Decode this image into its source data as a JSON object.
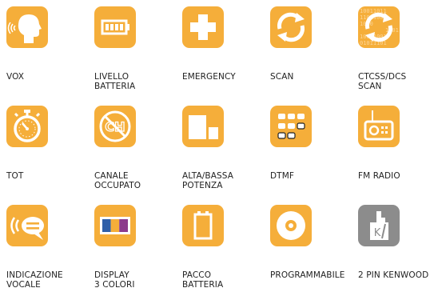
{
  "features": [
    {
      "label": [
        "VOX"
      ],
      "icon": "vox-head-icon"
    },
    {
      "label": [
        "LIVELLO",
        "BATTERIA"
      ],
      "icon": "battery-level-icon"
    },
    {
      "label": [
        "EMERGENCY"
      ],
      "icon": "emergency-cross-icon"
    },
    {
      "label": [
        "SCAN"
      ],
      "icon": "scan-arrows-icon"
    },
    {
      "label": [
        "CTCSS/DCS",
        "SCAN"
      ],
      "icon": "ctcss-dcs-scan-icon",
      "binary_text": [
        "10011011",
        "11011001",
        "1010",
        "1001",
        "10001001",
        "01011101"
      ]
    },
    {
      "label": [
        "TOT"
      ],
      "icon": "stopwatch-icon"
    },
    {
      "label": [
        "CANALE",
        "OCCUPATO"
      ],
      "icon": "busy-channel-icon",
      "glyph": "CH"
    },
    {
      "label": [
        "ALTA/BASSA",
        "POTENZA"
      ],
      "icon": "high-low-power-icon"
    },
    {
      "label": [
        "DTMF"
      ],
      "icon": "dtmf-keypad-icon"
    },
    {
      "label": [
        "FM RADIO"
      ],
      "icon": "fm-radio-icon"
    },
    {
      "label": [
        "INDICAZIONE",
        "VOCALE"
      ],
      "icon": "voice-prompt-icon"
    },
    {
      "label": [
        "DISPLAY",
        "3 COLORI"
      ],
      "icon": "three-color-display-icon",
      "colors": [
        "#2F5FA8",
        "#F5AE3A",
        "#8C3A8C"
      ]
    },
    {
      "label": [
        "PACCO",
        "BATTERIA"
      ],
      "icon": "battery-pack-icon"
    },
    {
      "label": [
        "PROGRAMMABILE"
      ],
      "icon": "cd-disc-icon"
    },
    {
      "label": [
        "2 PIN KENWOOD"
      ],
      "icon": "kenwood-pin-icon",
      "glyph": "K"
    }
  ],
  "colors": {
    "tile": "#F5AE3A",
    "tile_gray": "#8C8C8C",
    "label": "#222222"
  }
}
